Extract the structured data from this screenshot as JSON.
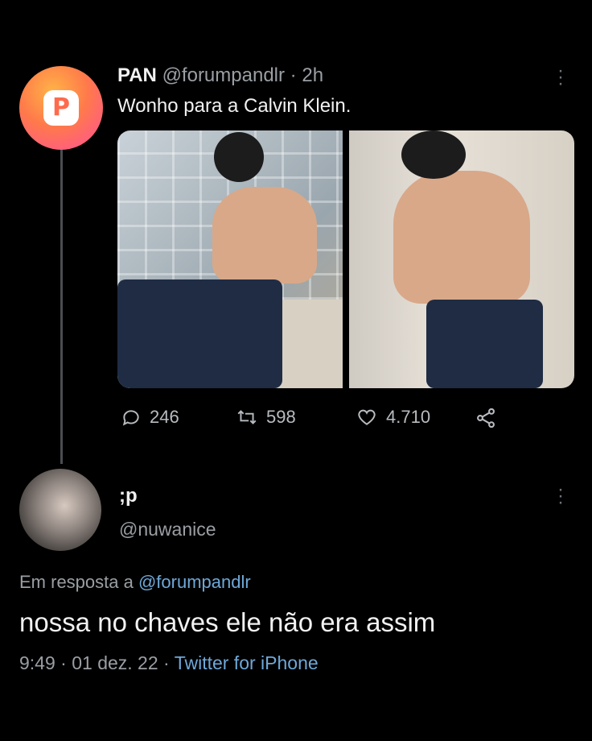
{
  "tweet": {
    "author_name": "PAN",
    "author_handle": "@forumpandlr",
    "separator": "·",
    "time_ago": "2h",
    "text": "Wonho para a Calvin Klein.",
    "avatar_letter": "P",
    "more_icon": "more-vertical-icon",
    "media_count": 2,
    "actions": {
      "replies": "246",
      "retweets": "598",
      "likes": "4.710"
    }
  },
  "reply": {
    "author_name": ";p",
    "author_handle": "@nuwanice",
    "in_reply_prefix": "Em resposta a",
    "in_reply_handle": "@forumpandlr",
    "text": "nossa no chaves ele não era assim",
    "time": "9:49",
    "date": "01 dez. 22",
    "separator": "·",
    "source": "Twitter for iPhone"
  },
  "colors": {
    "background": "#000000",
    "link": "#6ea8d8",
    "muted": "#9a9fa4",
    "avatar_gradient_start": "#ffb347",
    "avatar_gradient_end": "#ff4f9a"
  }
}
